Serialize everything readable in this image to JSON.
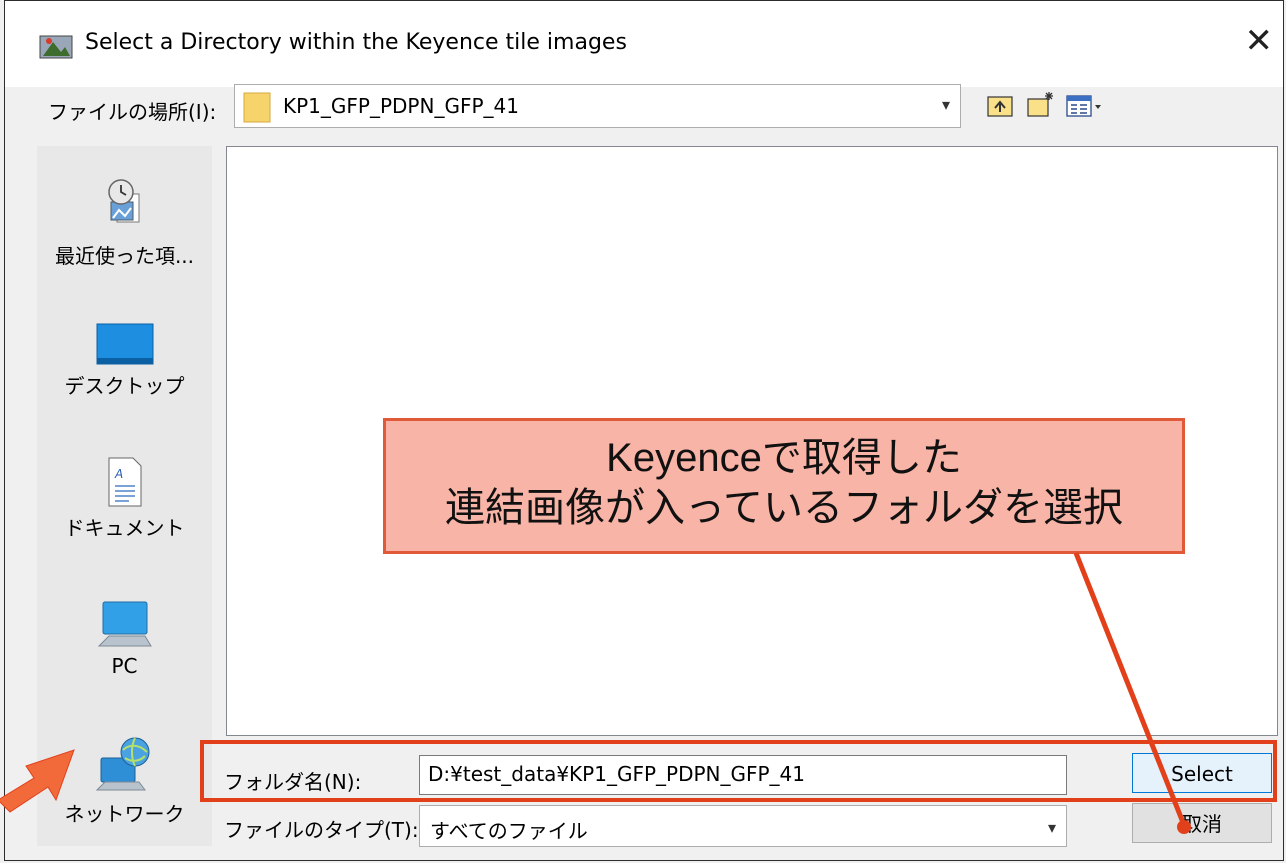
{
  "window": {
    "title": "Select a Directory within the Keyence tile images"
  },
  "look_in": {
    "label": "ファイルの場所(I):",
    "value": "KP1_GFP_PDPN_GFP_41"
  },
  "places": [
    {
      "label": "最近使った項..."
    },
    {
      "label": "デスクトップ"
    },
    {
      "label": "ドキュメント"
    },
    {
      "label": "PC"
    },
    {
      "label": "ネットワーク"
    }
  ],
  "folder_name": {
    "label": "フォルダ名(N):",
    "value": "D:¥test_data¥KP1_GFP_PDPN_GFP_41"
  },
  "file_type": {
    "label": "ファイルのタイプ(T):",
    "value": "すべてのファイル"
  },
  "buttons": {
    "select": "Select",
    "cancel": "取消"
  },
  "callout": {
    "line1": "Keyenceで取得した",
    "line2": "連結画像が入っているフォルダを選択"
  },
  "colors": {
    "accent": "#e2401a",
    "callout_fill": "#f8b4a6",
    "arrow": "#f26a3a"
  }
}
